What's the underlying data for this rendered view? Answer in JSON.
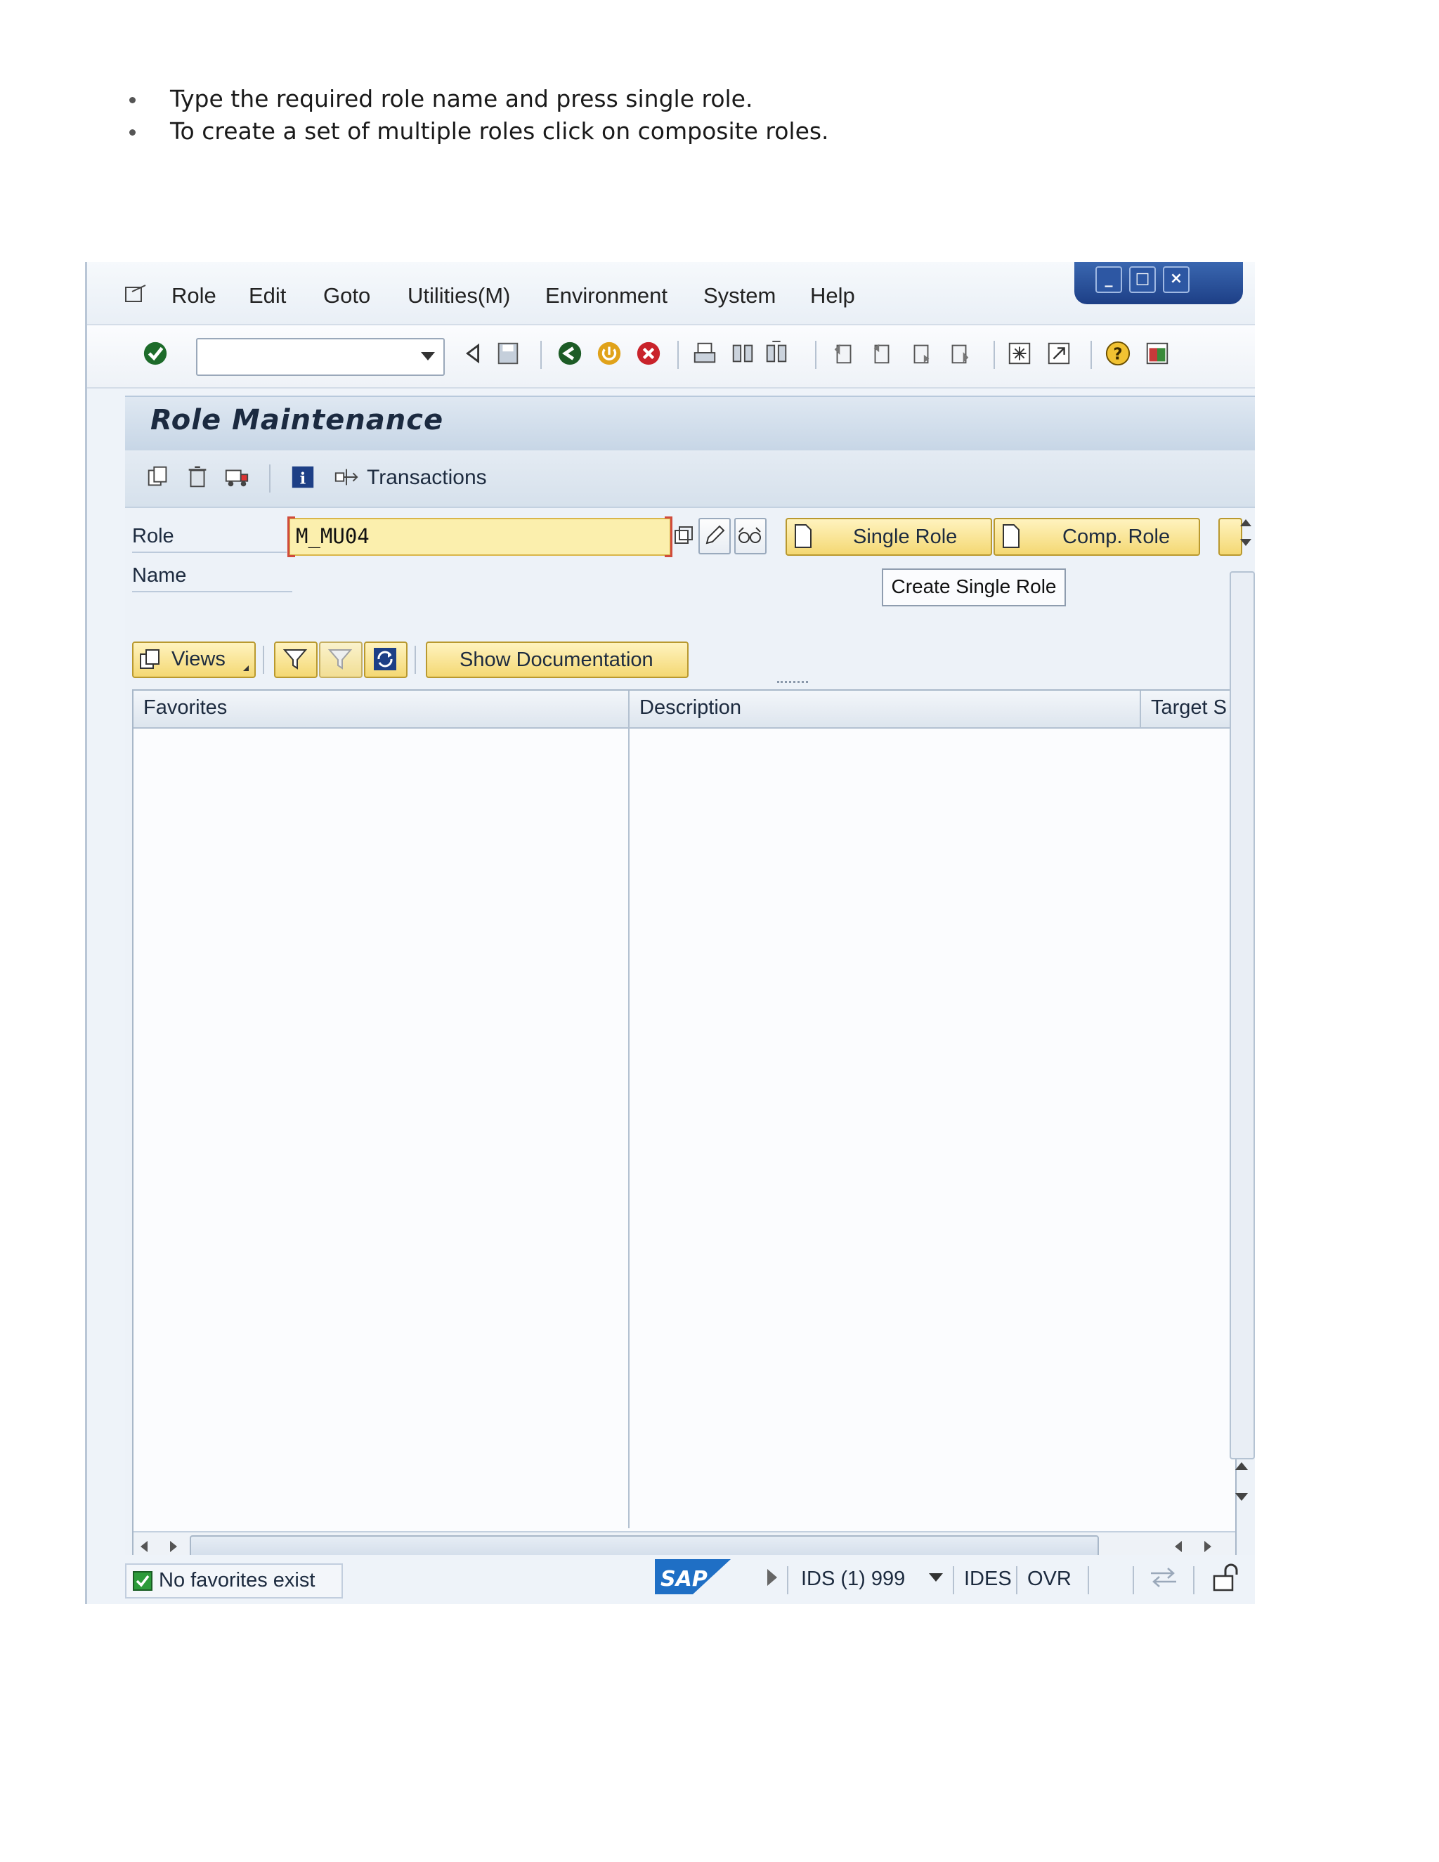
{
  "instructions": [
    "Type the required role name and press single role.",
    "To create a set of multiple roles click on composite roles."
  ],
  "menu": {
    "items": [
      "Role",
      "Edit",
      "Goto",
      "Utilities(M)",
      "Environment",
      "System",
      "Help"
    ]
  },
  "window_controls": [
    "minimize",
    "maximize",
    "close"
  ],
  "toolbar": {
    "command_field_value": "",
    "icons": [
      "enter-icon",
      "back-arrow-icon",
      "save-icon",
      "back-icon",
      "exit-icon",
      "cancel-icon",
      "print-icon",
      "find-icon",
      "find-next-icon",
      "first-page-icon",
      "previous-page-icon",
      "next-page-icon",
      "last-page-icon",
      "new-session-icon",
      "shortcut-icon",
      "help-icon",
      "customize-layout-icon"
    ]
  },
  "screen": {
    "title": "Role Maintenance",
    "app_toolbar": {
      "transactions_label": "Transactions"
    },
    "role_label": "Role",
    "role_value": "M_MU04",
    "name_label": "Name",
    "single_role_button": "Single Role",
    "comp_role_button": "Comp. Role",
    "tooltip": "Create Single Role",
    "views_button": "Views",
    "show_documentation_button": "Show Documentation",
    "tree_columns": [
      "Favorites",
      "Description",
      "Target S"
    ]
  },
  "status": {
    "message": "No favorites exist",
    "system": "IDS (1) 999",
    "server": "IDES",
    "mode": "OVR"
  },
  "colors": {
    "accent_yellow": "#f4d873",
    "title_blue": "#c7d6e6",
    "window_frame_blue": "#1d3f86"
  }
}
